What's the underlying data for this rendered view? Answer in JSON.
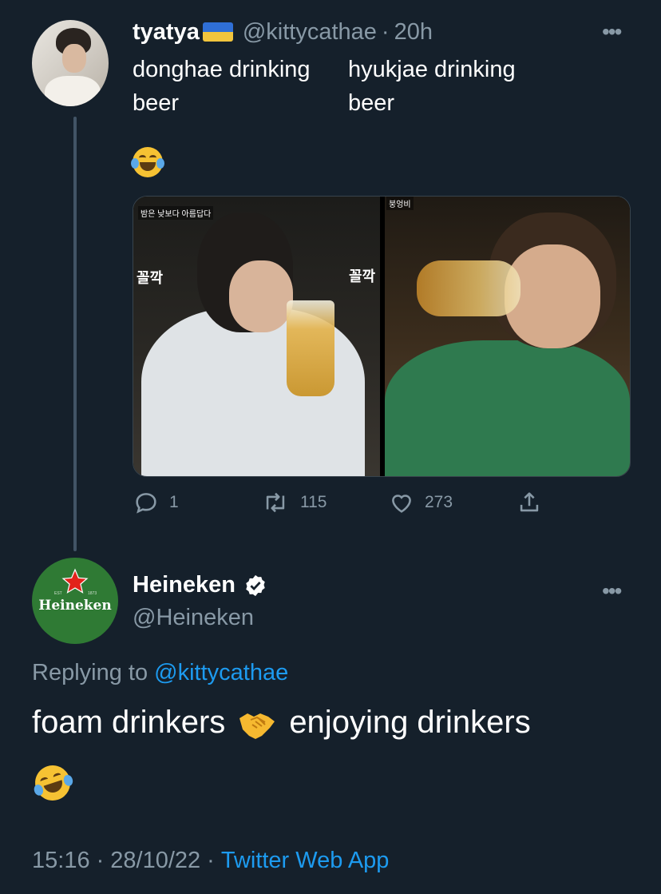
{
  "original_tweet": {
    "display_name": "tyatya",
    "flag_icon": "ukraine-flag-icon",
    "handle": "@kittycathae",
    "separator": "·",
    "time": "20h",
    "text_left": [
      "donghae drinking",
      "beer"
    ],
    "text_right": [
      "hyukjae drinking",
      "beer"
    ],
    "emoji": "😂",
    "media": {
      "left_caption_small": "밤은 낮보다 아름답다",
      "left_caption_big_1": "꼴깍",
      "left_caption_big_2": "꼴깍",
      "right_caption_small": "붕엉비"
    },
    "actions": {
      "reply_count": "1",
      "retweet_count": "115",
      "like_count": "273"
    }
  },
  "reply_tweet": {
    "display_name": "Heineken",
    "handle": "@Heineken",
    "avatar_brand": "Heineken",
    "avatar_tiny_left": "EST",
    "avatar_tiny_right": "1873",
    "replying_prefix": "Replying to",
    "replying_to": "@kittycathae",
    "text_before": "foam drinkers",
    "text_after": "enjoying drinkers",
    "emoji": "🤣",
    "timestamp_time": "15:16",
    "timestamp_date": "28/10/22",
    "source": "Twitter Web App"
  },
  "colors": {
    "background": "#15202b",
    "secondary_text": "#8899a6",
    "link": "#1d9bf0",
    "heineken_green": "#2f7a34"
  }
}
